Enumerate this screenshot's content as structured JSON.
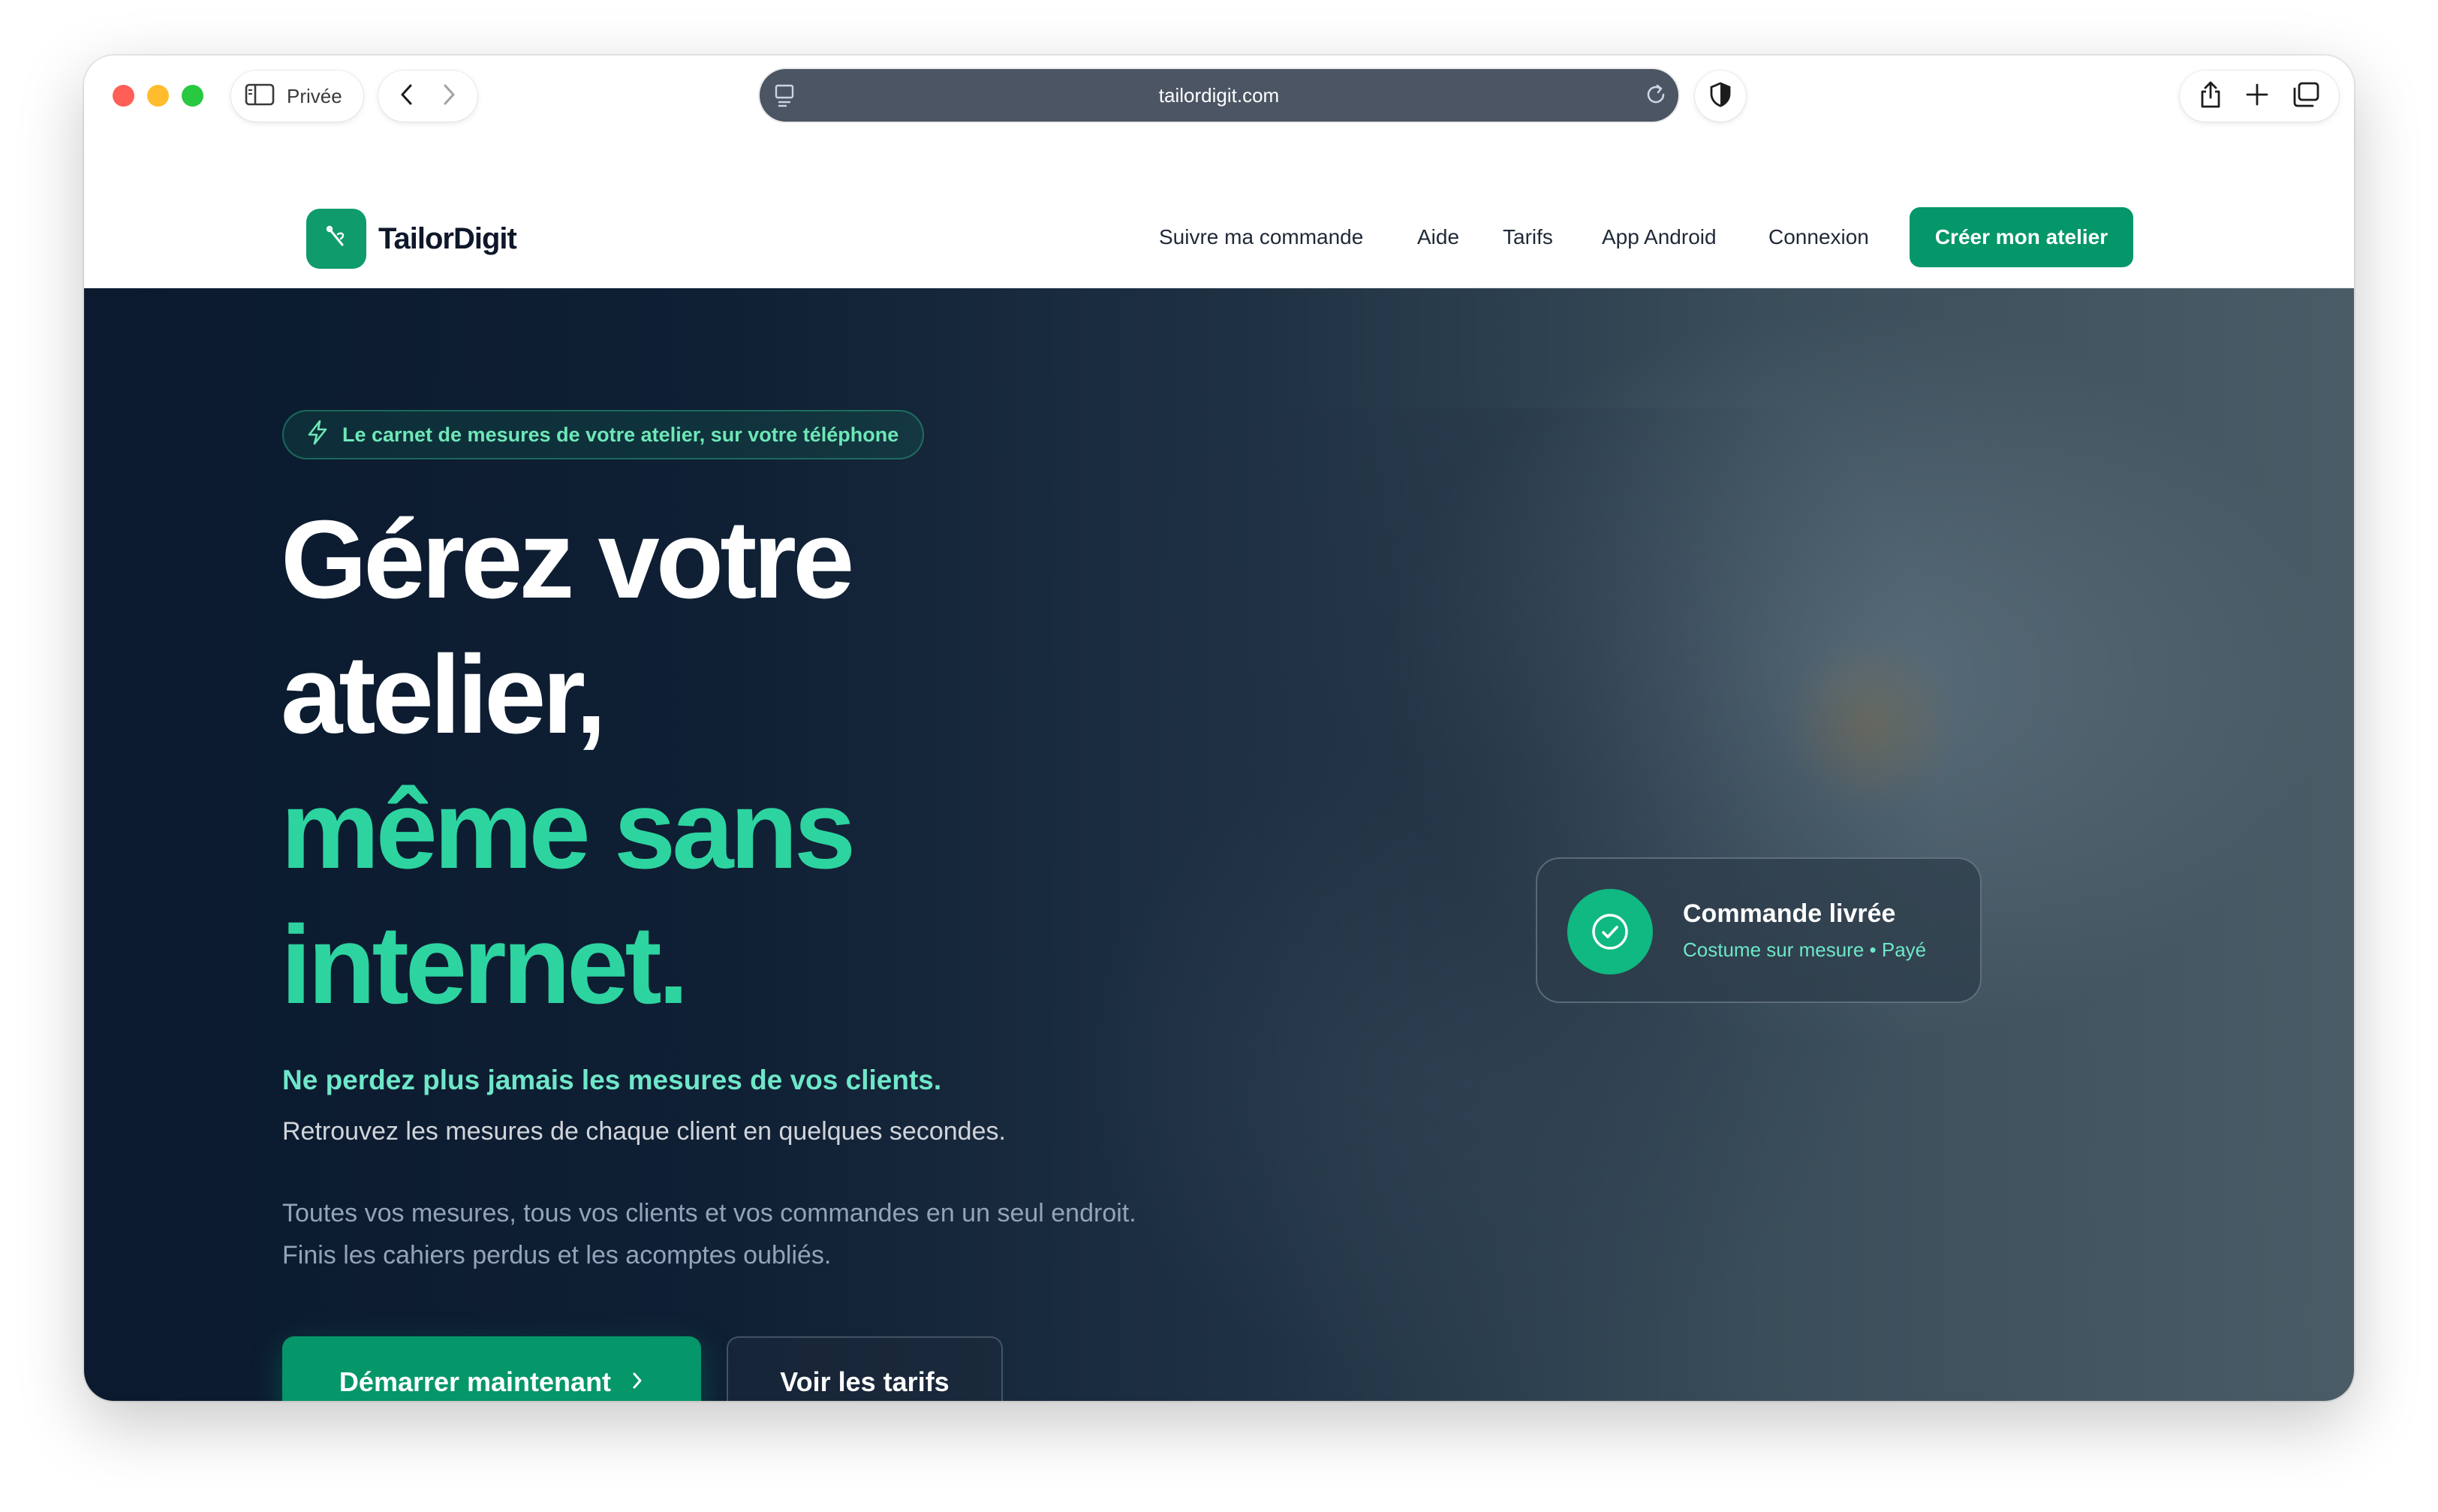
{
  "browser": {
    "private_label": "Privée",
    "url": "tailordigit.com"
  },
  "header": {
    "brand": "TailorDigit",
    "nav": [
      {
        "label": "Suivre ma commande"
      },
      {
        "label": "Aide"
      },
      {
        "label": "Tarifs"
      },
      {
        "label": "App Android"
      },
      {
        "label": "Connexion"
      }
    ],
    "cta": "Créer mon atelier"
  },
  "hero": {
    "badge": "Le carnet de mesures de votre atelier, sur votre téléphone",
    "headline_white_1": "Gérez votre",
    "headline_white_2": "atelier,",
    "headline_green_1": "même sans",
    "headline_green_2": "internet.",
    "tagline": "Ne perdez plus jamais les mesures de vos clients.",
    "subtitle": "Retrouvez les mesures de chaque client en quelques secondes.",
    "description": "Toutes vos mesures, tous vos clients et vos commandes en un seul endroit. Finis les cahiers perdus et les acomptes oubliés.",
    "primary_button": "Démarrer maintenant",
    "secondary_button": "Voir les tarifs"
  },
  "status_card": {
    "title": "Commande livrée",
    "subtitle": "Costume sur mesure • Payé"
  },
  "colors": {
    "brand_green": "#059669",
    "accent_green": "#2dd4a0",
    "hero_dark": "#0b1a2e"
  },
  "icons": {
    "sidebar": "sidebar-icon",
    "back": "chevron-left-icon",
    "forward": "chevron-right-icon",
    "reader": "reader-icon",
    "reload": "reload-icon",
    "shield": "shield-icon",
    "share": "share-icon",
    "new_tab": "plus-icon",
    "tabs": "tabs-overview-icon",
    "logo": "needle-icon",
    "badge": "lightning-icon",
    "check": "check-circle-icon"
  }
}
